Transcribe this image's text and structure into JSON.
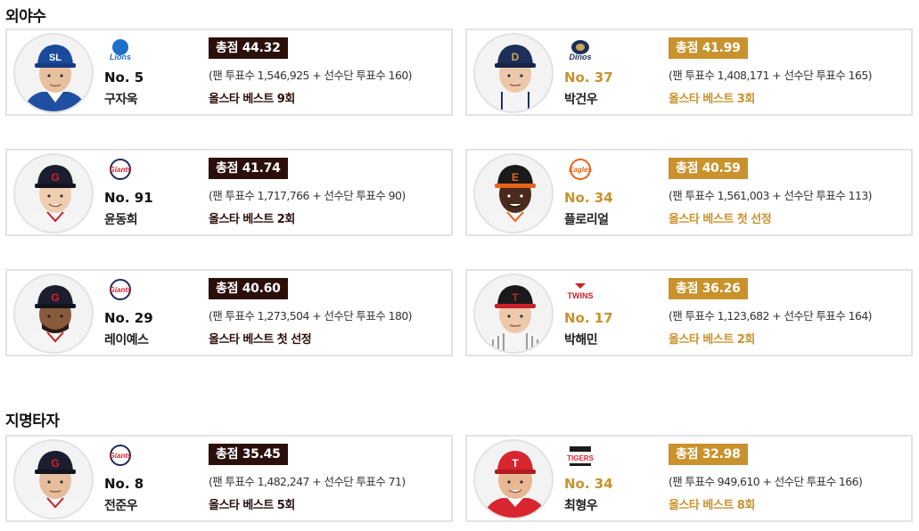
{
  "sections": [
    {
      "title": "외야수"
    },
    {
      "title": "지명타자"
    }
  ],
  "players": [
    {
      "number": "No. 5",
      "name": "구자욱",
      "team_logo_text": "Lions",
      "team_logo_icon": "lions-logo-icon",
      "cap_letter": "SL",
      "score": "총점 44.32",
      "votes": "(팬 투표수 1,546,925 + 선수단 투표수 160)",
      "allstar": "올스타 베스트 9회"
    },
    {
      "number": "No. 37",
      "name": "박건우",
      "team_logo_text": "Dinos",
      "team_logo_icon": "dinos-logo-icon",
      "cap_letter": "D",
      "score": "총점 41.99",
      "votes": "(팬 투표수 1,408,171 + 선수단 투표수 165)",
      "allstar": "올스타 베스트 3회"
    },
    {
      "number": "No. 91",
      "name": "윤동희",
      "team_logo_text": "Giants",
      "team_logo_icon": "giants-logo-icon",
      "cap_letter": "G",
      "score": "총점 41.74",
      "votes": "(팬 투표수 1,717,766 + 선수단 투표수 90)",
      "allstar": "올스타 베스트 2회"
    },
    {
      "number": "No. 34",
      "name": "플로리얼",
      "team_logo_text": "Eagles",
      "team_logo_icon": "eagles-logo-icon",
      "cap_letter": "E",
      "score": "총점 40.59",
      "votes": "(팬 투표수 1,561,003 + 선수단 투표수 113)",
      "allstar": "올스타 베스트 첫 선정"
    },
    {
      "number": "No. 29",
      "name": "레이예스",
      "team_logo_text": "Giants",
      "team_logo_icon": "giants-logo-icon",
      "cap_letter": "G",
      "score": "총점 40.60",
      "votes": "(팬 투표수 1,273,504 + 선수단 투표수 180)",
      "allstar": "올스타 베스트 첫 선정"
    },
    {
      "number": "No. 17",
      "name": "박해민",
      "team_logo_text": "TWINS",
      "team_logo_icon": "twins-logo-icon",
      "cap_letter": "T",
      "score": "총점 36.26",
      "votes": "(팬 투표수 1,123,682 + 선수단 투표수 164)",
      "allstar": "올스타 베스트 2회"
    },
    {
      "number": "No. 8",
      "name": "전준우",
      "team_logo_text": "Giants",
      "team_logo_icon": "giants-logo-icon",
      "cap_letter": "G",
      "score": "총점 35.45",
      "votes": "(팬 투표수 1,482,247 + 선수단 투표수 71)",
      "allstar": "올스타 베스트 5회"
    },
    {
      "number": "No. 34",
      "name": "최형우",
      "team_logo_text": "TIGERS",
      "team_logo_icon": "tigers-logo-icon",
      "cap_letter": "T",
      "score": "총점 32.98",
      "votes": "(팬 투표수 949,610 + 선수단 투표수 166)",
      "allstar": "올스타 베스트 8회"
    }
  ],
  "colors": {
    "dark_accent": "#2a0f0b",
    "gold_accent": "#c9922c",
    "card_border": "#e3e3e3"
  }
}
